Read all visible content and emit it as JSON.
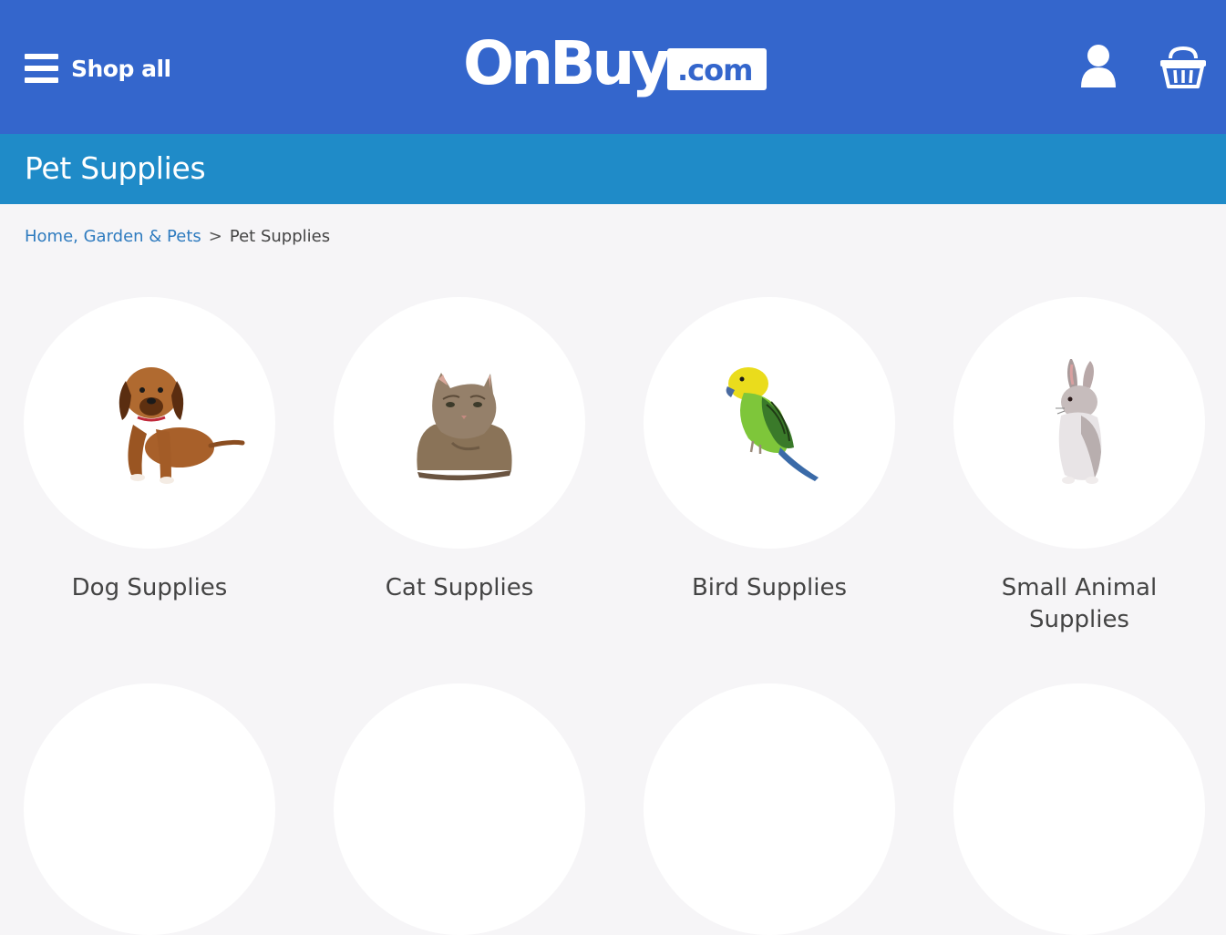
{
  "header": {
    "shop_all_label": "Shop all",
    "logo_text": "OnBuy",
    "logo_suffix": ".com",
    "brand_color": "#3466cc"
  },
  "title_bar": {
    "title": "Pet Supplies",
    "color": "#1f8bc8"
  },
  "breadcrumb": {
    "parent_label": "Home, Garden & Pets",
    "separator": ">",
    "current_label": "Pet Supplies"
  },
  "categories": [
    {
      "label": "Dog Supplies",
      "icon": "dog-image"
    },
    {
      "label": "Cat Supplies",
      "icon": "cat-image"
    },
    {
      "label": "Bird Supplies",
      "icon": "bird-image"
    },
    {
      "label": "Small Animal Supplies",
      "icon": "rabbit-image"
    }
  ]
}
